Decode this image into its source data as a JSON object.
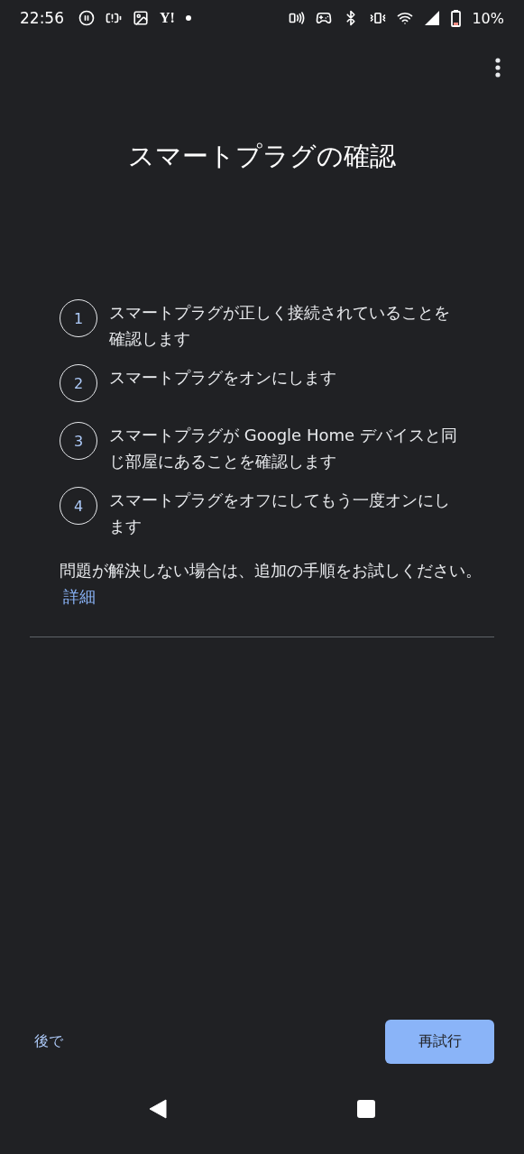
{
  "status_bar": {
    "time": "22:56",
    "carrier_logo": "Y!",
    "battery": "10%"
  },
  "title": "スマートプラグの確認",
  "steps": [
    {
      "number": "1",
      "text": "スマートプラグが正しく接続されていることを確認します"
    },
    {
      "number": "2",
      "text": "スマートプラグをオンにします"
    },
    {
      "number": "3",
      "text": "スマートプラグが Google Home デバイスと同じ部屋にあることを確認します"
    },
    {
      "number": "4",
      "text": "スマートプラグをオフにしてもう一度オンにします"
    }
  ],
  "help": {
    "text": "問題が解決しない場合は、追加の手順をお試しください。",
    "link": "詳細"
  },
  "buttons": {
    "secondary": "後で",
    "primary": "再試行"
  }
}
